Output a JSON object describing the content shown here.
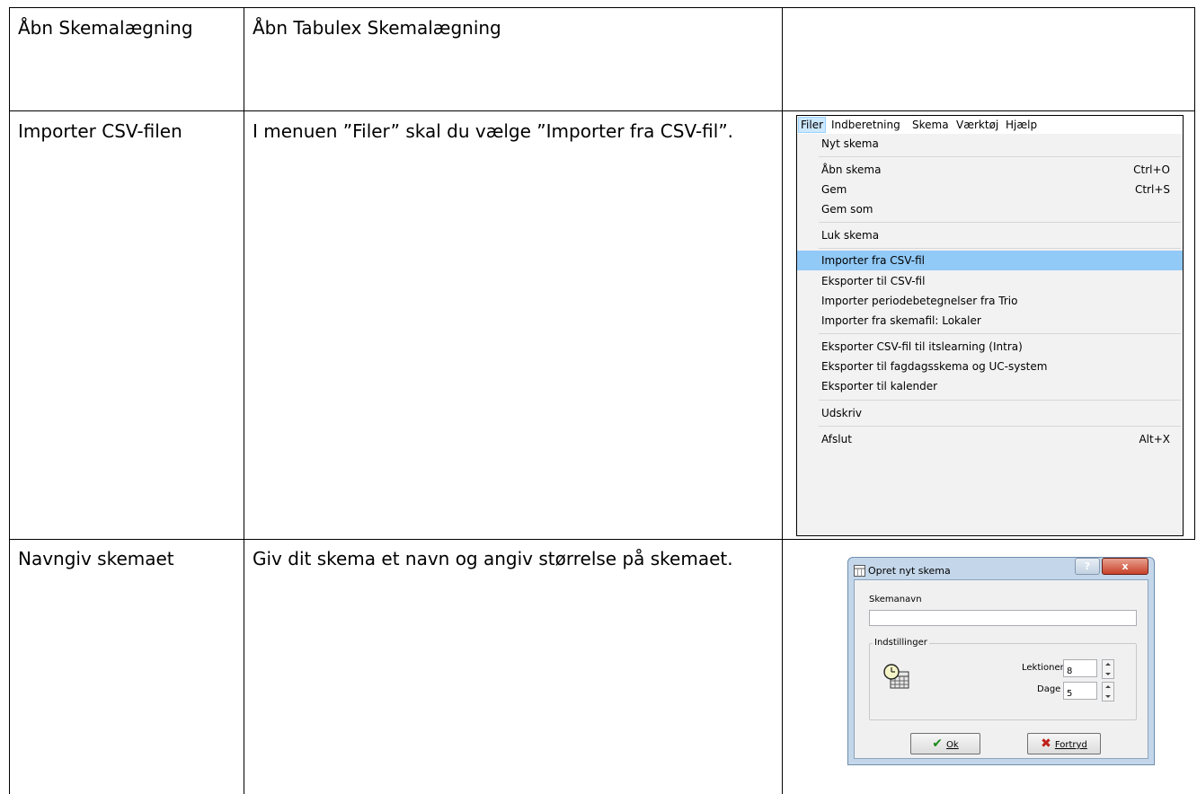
{
  "rows": [
    {
      "step": "Åbn Skemalægning",
      "description": "Åbn Tabulex Skemalægning"
    },
    {
      "step": "Importer CSV-filen",
      "description": "I menuen ”Filer” skal du vælge ”Importer fra CSV-fil”."
    },
    {
      "step": "Navngiv skemaet",
      "description": "Giv dit skema et navn og angiv størrelse på skemaet."
    }
  ],
  "menu": {
    "menubar": [
      "Filer",
      "Indberetning",
      "Skema",
      "Værktøj",
      "Hjælp"
    ],
    "items": [
      {
        "label": "Nyt skema",
        "shortcut": ""
      },
      {
        "label": "Åbn skema",
        "shortcut": "Ctrl+O"
      },
      {
        "label": "Gem",
        "shortcut": "Ctrl+S"
      },
      {
        "label": "Gem som",
        "shortcut": ""
      },
      {
        "label": "Luk skema",
        "shortcut": ""
      },
      {
        "label": "Importer fra CSV-fil",
        "shortcut": "",
        "highlighted": true
      },
      {
        "label": "Eksporter til CSV-fil",
        "shortcut": ""
      },
      {
        "label": "Importer periodebetegnelser fra Trio",
        "shortcut": ""
      },
      {
        "label": "Importer fra skemafil: Lokaler",
        "shortcut": ""
      },
      {
        "label": "Eksporter CSV-fil til itslearning (Intra)",
        "shortcut": ""
      },
      {
        "label": "Eksporter til fagdagsskema og UC-system",
        "shortcut": ""
      },
      {
        "label": "Eksporter til kalender",
        "shortcut": ""
      },
      {
        "label": "Udskriv",
        "shortcut": ""
      },
      {
        "label": "Afslut",
        "shortcut": "Alt+X"
      }
    ]
  },
  "dialog": {
    "title": "Opret nyt skema",
    "help_button": "?",
    "close_button": "x",
    "name_label": "Skemanavn",
    "name_value": "",
    "group_label": "Indstillinger",
    "lektioner_label": "Lektioner",
    "lektioner_value": "8",
    "dage_label": "Dage",
    "dage_value": "5",
    "ok_label": "Ok",
    "cancel_label": "Fortryd"
  }
}
